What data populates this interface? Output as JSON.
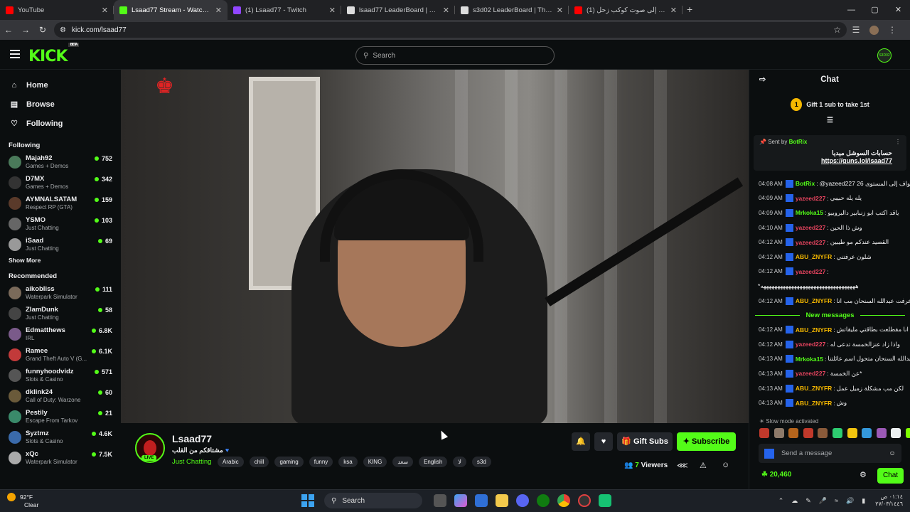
{
  "browser": {
    "tabs": [
      {
        "title": "YouTube",
        "color": "#ff0000",
        "active": false
      },
      {
        "title": "Lsaad77 Stream - Watch Live on Kick",
        "color": "#53fc18",
        "active": true
      },
      {
        "title": "(1) Lsaad77 - Twitch",
        "color": "#9146ff",
        "active": false
      },
      {
        "title": "lsaad77 LeaderBoard | The best",
        "color": "#dddddd",
        "active": false
      },
      {
        "title": "s3d02 LeaderBoard | The best",
        "color": "#dddddd",
        "active": false
      },
      {
        "title": "(1) أستمع إلى صوت كوكب زحل",
        "color": "#ff0000",
        "active": false
      }
    ],
    "url": "kick.com/lsaad77"
  },
  "header": {
    "logo": "KICK",
    "beta": "BETA",
    "search_placeholder": "Search",
    "user_badge": "S3D02"
  },
  "sidebar": {
    "nav": [
      {
        "label": "Home",
        "icon": "home-icon"
      },
      {
        "label": "Browse",
        "icon": "browse-icon"
      },
      {
        "label": "Following",
        "icon": "heart-icon"
      }
    ],
    "following_title": "Following",
    "following": [
      {
        "name": "Majah92",
        "category": "Games + Demos",
        "viewers": "752",
        "color": "#4a7a5a"
      },
      {
        "name": "D7MX",
        "category": "Games + Demos",
        "viewers": "342",
        "color": "#333333"
      },
      {
        "name": "AYMNALSATAM",
        "category": "Respect RP (GTA)",
        "viewers": "159",
        "color": "#5a3a2a"
      },
      {
        "name": "YSMO",
        "category": "Just Chatting",
        "viewers": "103",
        "color": "#666666"
      },
      {
        "name": "iSaad",
        "category": "Just Chatting",
        "viewers": "69",
        "color": "#999999"
      }
    ],
    "show_more": "Show More",
    "recommended_title": "Recommended",
    "recommended": [
      {
        "name": "aikobliss",
        "category": "Waterpark Simulator",
        "viewers": "111",
        "color": "#7a6a5a"
      },
      {
        "name": "ZlamDunk",
        "category": "Just Chatting",
        "viewers": "58",
        "color": "#444444"
      },
      {
        "name": "Edmatthews",
        "category": "IRL",
        "viewers": "6.8K",
        "color": "#7a5a8a"
      },
      {
        "name": "Ramee",
        "category": "Grand Theft Auto V (G...",
        "viewers": "6.1K",
        "color": "#c23a3a"
      },
      {
        "name": "funnyhoodvidz",
        "category": "Slots & Casino",
        "viewers": "571",
        "color": "#555555"
      },
      {
        "name": "dklink24",
        "category": "Call of Duty: Warzone",
        "viewers": "60",
        "color": "#6a5a3a"
      },
      {
        "name": "Pestily",
        "category": "Escape From Tarkov",
        "viewers": "21",
        "color": "#3a8a6a"
      },
      {
        "name": "Syztmz",
        "category": "Slots & Casino",
        "viewers": "4.6K",
        "color": "#3a6aaa"
      },
      {
        "name": "xQc",
        "category": "Waterpark Simulator",
        "viewers": "7.5K",
        "color": "#aaaaaa"
      }
    ]
  },
  "stream": {
    "name": "Lsaad77",
    "live": "LIVE",
    "title": "مشتاقكم من القلب",
    "category": "Just Chatting",
    "tags": [
      "Arabic",
      "chill",
      "gaming",
      "funny",
      "ksa",
      "KING",
      "سعد",
      "English",
      "لا",
      "s3d"
    ],
    "gift_subs": "Gift Subs",
    "subscribe": "Subscribe",
    "viewers": "7",
    "viewers_label": "Viewers"
  },
  "chat": {
    "title": "Chat",
    "gift_rank": "1",
    "gift_text": "Gift 1 sub to take 1st",
    "pinned": {
      "sent_by": "Sent by",
      "bot": "BotRix",
      "text": "حسابات السوشل ميديا",
      "link": "https://guns.lol/lsaad77"
    },
    "messages": [
      {
        "time": "04:08 AM",
        "user": "BotRix",
        "color": "#53fc18",
        "text": "@yazeed227 تمت ترقيع سجواف إلى المستوى 26"
      },
      {
        "time": "04:09 AM",
        "user": "yazeed227",
        "color": "#e94560",
        "text": "يله يله حبيبي"
      },
      {
        "time": "04:09 AM",
        "user": "Mrkoka15",
        "color": "#53fc18",
        "text": "ياقد اكتب ابو زنبابير دالبروبيو"
      },
      {
        "time": "04:10 AM",
        "user": "yazeed227",
        "color": "#e94560",
        "text": "وش ذا الحين"
      },
      {
        "time": "04:12 AM",
        "user": "yazeed227",
        "color": "#e94560",
        "text": "القصيد عندكم مو طيبين"
      },
      {
        "time": "04:12 AM",
        "user": "ABU_ZNYFR",
        "color": "#f5b800",
        "text": "شلون عرفتني"
      },
      {
        "time": "04:12 AM",
        "user": "yazeed227",
        "color": "#e94560",
        "text": ""
      },
      {
        "time": "",
        "user": "",
        "color": "#ffffff",
        "text": "*ههههههههههههههههههههههههههههههههههه"
      },
      {
        "time": "04:12 AM",
        "user": "ABU_ZNYFR",
        "color": "#f5b800",
        "text": "عرفت عبدالله السنحان مب انا"
      }
    ],
    "new_messages": "New messages",
    "messages2": [
      {
        "time": "04:12 AM",
        "user": "ABU_ZNYFR",
        "color": "#f5b800",
        "text": "انا مقطلعت بطاقتي مليقاتش"
      },
      {
        "time": "04:12 AM",
        "user": "yazeed227",
        "color": "#e94560",
        "text": "واذا زاد عنزالخمسة تدعى له"
      },
      {
        "time": "04:13 AM",
        "user": "Mrkoka15",
        "color": "#53fc18",
        "text": "عبدالله السنحان متحول اسم عائلتنا"
      },
      {
        "time": "04:13 AM",
        "user": "yazeed227",
        "color": "#e94560",
        "text": "عن الخمسة*"
      },
      {
        "time": "04:13 AM",
        "user": "ABU_ZNYFR",
        "color": "#f5b800",
        "text": "لكن مب مشكلة زميل عمل"
      },
      {
        "time": "04:13 AM",
        "user": "ABU_ZNYFR",
        "color": "#f5b800",
        "text": "وش"
      }
    ],
    "slow_mode": "Slow mode activated",
    "emote_colors": [
      "#c0392b",
      "#8e7a6a",
      "#b5651d",
      "#c0392b",
      "#8a5a3a",
      "#2ecc71",
      "#f1c40f",
      "#3498db",
      "#9b59b6",
      "#ecf0f1",
      "#7fff00",
      "#27ae60"
    ],
    "placeholder": "Send a message",
    "points": "20,460",
    "chat_button": "Chat"
  },
  "taskbar": {
    "temp": "92°F",
    "weather": "Clear",
    "search": "Search",
    "time": "٠١:١٤ ص",
    "date": "٢٧/٠٣/١٤٤٦"
  }
}
